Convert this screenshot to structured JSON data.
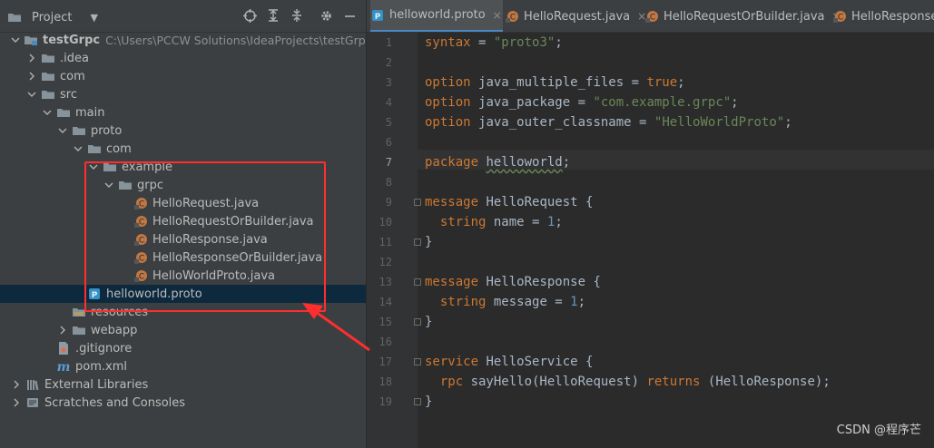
{
  "project_panel": {
    "title": "Project",
    "tree": [
      {
        "label": "testGrpc",
        "path": "C:\\Users\\PCCW Solutions\\IdeaProjects\\testGrpc",
        "indent": 0,
        "expand": "open",
        "icon": "module-folder-icon",
        "bold": true
      },
      {
        "label": ".idea",
        "indent": 1,
        "expand": "closed",
        "icon": "folder-icon"
      },
      {
        "label": "com",
        "indent": 1,
        "expand": "closed",
        "icon": "folder-icon"
      },
      {
        "label": "src",
        "indent": 1,
        "expand": "open",
        "icon": "folder-icon"
      },
      {
        "label": "main",
        "indent": 2,
        "expand": "open",
        "icon": "folder-icon"
      },
      {
        "label": "proto",
        "indent": 3,
        "expand": "open",
        "icon": "folder-icon"
      },
      {
        "label": "com",
        "indent": 4,
        "expand": "open",
        "icon": "folder-icon"
      },
      {
        "label": "example",
        "indent": 5,
        "expand": "open",
        "icon": "folder-icon"
      },
      {
        "label": "grpc",
        "indent": 6,
        "expand": "open",
        "icon": "folder-icon"
      },
      {
        "label": "HelloRequest.java",
        "indent": 7,
        "expand": "none",
        "icon": "java-class-icon"
      },
      {
        "label": "HelloRequestOrBuilder.java",
        "indent": 7,
        "expand": "none",
        "icon": "java-class-icon"
      },
      {
        "label": "HelloResponse.java",
        "indent": 7,
        "expand": "none",
        "icon": "java-class-icon"
      },
      {
        "label": "HelloResponseOrBuilder.java",
        "indent": 7,
        "expand": "none",
        "icon": "java-class-icon"
      },
      {
        "label": "HelloWorldProto.java",
        "indent": 7,
        "expand": "none",
        "icon": "java-class-icon"
      },
      {
        "label": "helloworld.proto",
        "indent": 4,
        "expand": "none",
        "icon": "proto-file-icon",
        "selected": true
      },
      {
        "label": "resources",
        "indent": 3,
        "expand": "none",
        "icon": "resources-folder-icon"
      },
      {
        "label": "webapp",
        "indent": 3,
        "expand": "closed",
        "icon": "folder-icon"
      },
      {
        "label": ".gitignore",
        "indent": 2,
        "expand": "none",
        "icon": "gitignore-file-icon"
      },
      {
        "label": "pom.xml",
        "indent": 2,
        "expand": "none",
        "icon": "maven-file-icon"
      },
      {
        "label": "External Libraries",
        "indent": 0,
        "expand": "closed",
        "icon": "libraries-icon"
      },
      {
        "label": "Scratches and Consoles",
        "indent": 0,
        "expand": "closed",
        "icon": "scratches-icon"
      }
    ]
  },
  "tabs": [
    {
      "label": "helloworld.proto",
      "icon": "proto-file-icon",
      "active": true,
      "closable": true
    },
    {
      "label": "HelloRequest.java",
      "icon": "java-class-icon",
      "active": false,
      "closable": true
    },
    {
      "label": "HelloRequestOrBuilder.java",
      "icon": "java-class-icon",
      "active": false,
      "closable": true
    },
    {
      "label": "HelloResponse",
      "icon": "java-class-icon",
      "active": false,
      "closable": false
    }
  ],
  "editor": {
    "current_line": 7,
    "lines": [
      {
        "n": "1",
        "t": [
          [
            "kw",
            "syntax"
          ],
          [
            "p",
            " = "
          ],
          [
            "str",
            "\"proto3\""
          ],
          [
            "p",
            ";"
          ]
        ]
      },
      {
        "n": "2",
        "t": []
      },
      {
        "n": "3",
        "t": [
          [
            "kw",
            "option "
          ],
          [
            "p",
            "java_multiple_files = "
          ],
          [
            "kw",
            "true"
          ],
          [
            "p",
            ";"
          ]
        ]
      },
      {
        "n": "4",
        "t": [
          [
            "kw",
            "option "
          ],
          [
            "p",
            "java_package = "
          ],
          [
            "str",
            "\"com.example.grpc\""
          ],
          [
            "p",
            ";"
          ]
        ]
      },
      {
        "n": "5",
        "t": [
          [
            "kw",
            "option "
          ],
          [
            "p",
            "java_outer_classname = "
          ],
          [
            "str",
            "\"HelloWorldProto\""
          ],
          [
            "p",
            ";"
          ]
        ]
      },
      {
        "n": "6",
        "t": []
      },
      {
        "n": "7",
        "t": [
          [
            "kw",
            "package "
          ],
          [
            "under",
            "helloworld"
          ],
          [
            "p",
            ";"
          ]
        ]
      },
      {
        "n": "8",
        "t": []
      },
      {
        "n": "9",
        "t": [
          [
            "kw",
            "message "
          ],
          [
            "p",
            "HelloRequest {"
          ]
        ]
      },
      {
        "n": "10",
        "t": [
          [
            "p",
            "  "
          ],
          [
            "kw",
            "string "
          ],
          [
            "p",
            "name = "
          ],
          [
            "num",
            "1"
          ],
          [
            "p",
            ";"
          ]
        ]
      },
      {
        "n": "11",
        "t": [
          [
            "p",
            "}"
          ]
        ]
      },
      {
        "n": "12",
        "t": []
      },
      {
        "n": "13",
        "t": [
          [
            "kw",
            "message "
          ],
          [
            "p",
            "HelloResponse {"
          ]
        ]
      },
      {
        "n": "14",
        "t": [
          [
            "p",
            "  "
          ],
          [
            "kw",
            "string "
          ],
          [
            "p",
            "message = "
          ],
          [
            "num",
            "1"
          ],
          [
            "p",
            ";"
          ]
        ]
      },
      {
        "n": "15",
        "t": [
          [
            "p",
            "}"
          ]
        ]
      },
      {
        "n": "16",
        "t": []
      },
      {
        "n": "17",
        "t": [
          [
            "kw",
            "service "
          ],
          [
            "p",
            "HelloService {"
          ]
        ]
      },
      {
        "n": "18",
        "t": [
          [
            "p",
            "  "
          ],
          [
            "kw",
            "rpc "
          ],
          [
            "p",
            "sayHello(HelloRequest) "
          ],
          [
            "kw",
            "returns "
          ],
          [
            "p",
            "(HelloResponse);"
          ]
        ]
      },
      {
        "n": "19",
        "t": [
          [
            "p",
            "}"
          ]
        ]
      }
    ]
  },
  "watermark": "CSDN @程序芒",
  "colors": {
    "annotation": "#ff2e2e",
    "selection": "#0d293e",
    "accent": "#4a88c7"
  }
}
